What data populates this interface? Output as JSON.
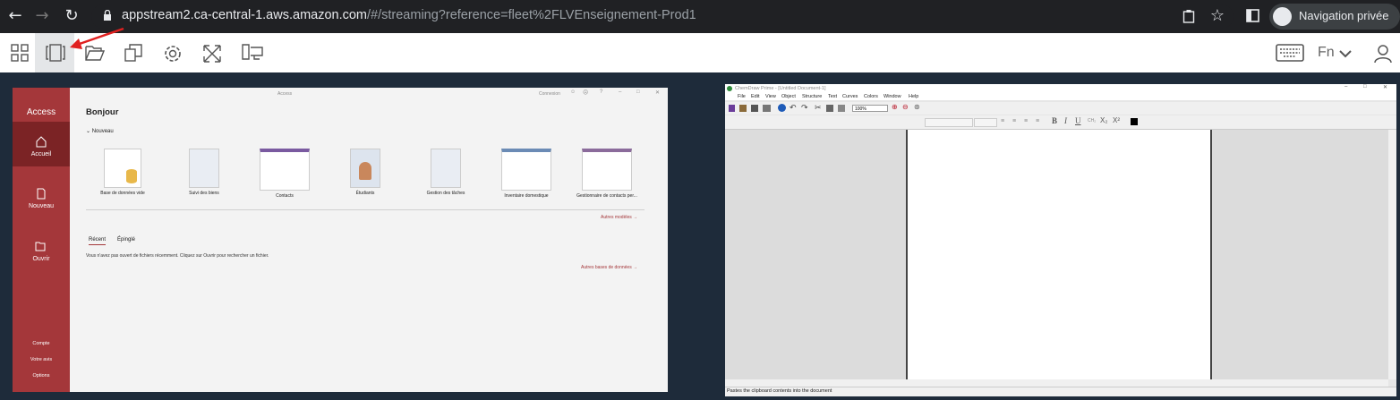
{
  "browser": {
    "url_host": "appstream2.ca-central-1.aws.amazon.com",
    "url_path": "/#/streaming?reference=fleet%2FLVEnseignement-Prod1",
    "incognito_label": "Navigation privée"
  },
  "toolbar": {
    "fn_label": "Fn"
  },
  "access": {
    "brand": "Access",
    "window_title": "Access",
    "connexion": "Connexion",
    "nav": {
      "home": "Accueil",
      "new": "Nouveau",
      "open": "Ouvrir"
    },
    "footer": {
      "account": "Compte",
      "feedback": "Votre avis",
      "options": "Options"
    },
    "greeting": "Bonjour",
    "section_new": "Nouveau",
    "templates": [
      "Base de données vide",
      "Suivi des biens",
      "Contacts",
      "Étudiants",
      "Gestion des tâches",
      "Inventaire domestique",
      "Gestionnaire de contacts per..."
    ],
    "more_templates": "Autres modèles",
    "tabs": {
      "recent": "Récent",
      "pinned": "Épinglé"
    },
    "empty_message": "Vous n'avez pas ouvert de fichiers récemment. Cliquez sur Ouvrir pour rechercher un fichier.",
    "more_databases": "Autres bases de données"
  },
  "chemdraw": {
    "title": "ChemDraw Prime - [Untitled Document-1]",
    "menus": [
      "File",
      "Edit",
      "View",
      "Object",
      "Structure",
      "Text",
      "Curves",
      "Colors",
      "Window",
      "Help"
    ],
    "zoom": "100%",
    "status": "Pastes the clipboard contents into the document"
  },
  "colors": {
    "access_red": "#a4373a",
    "access_red_dark": "#7b2325",
    "desktop_bg": "#1e2b3a"
  }
}
